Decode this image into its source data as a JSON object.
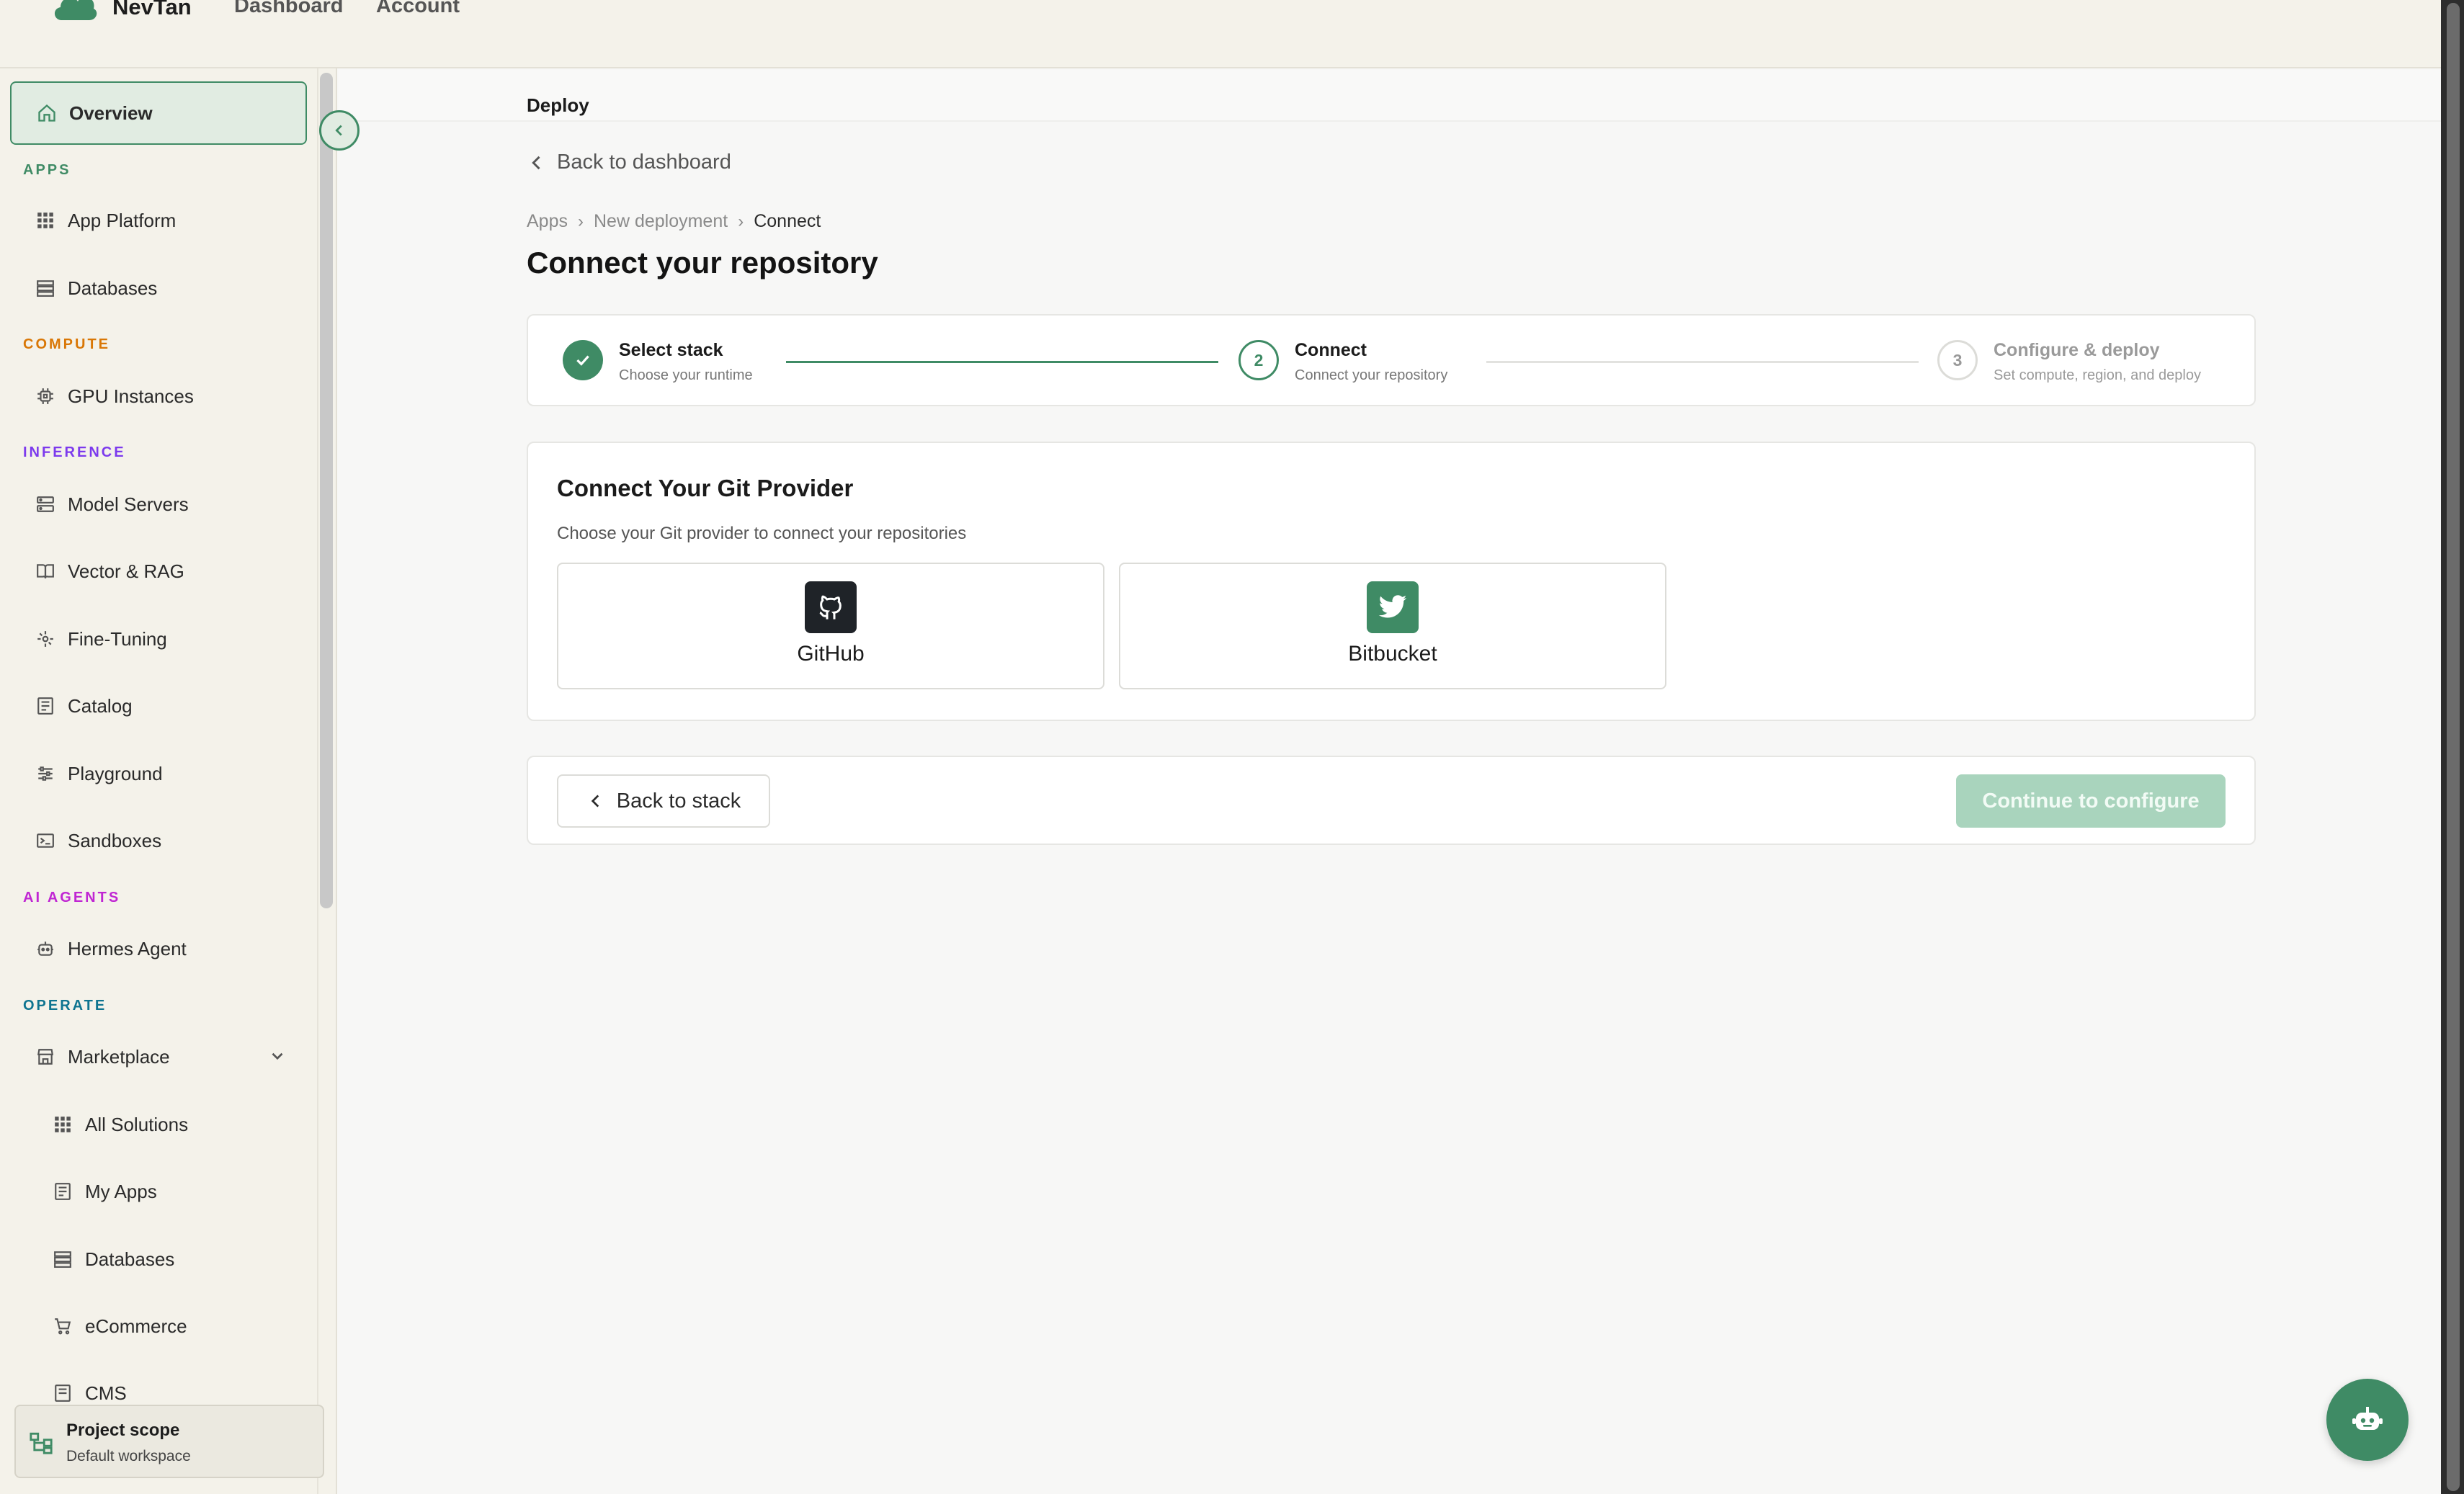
{
  "topbar": {
    "brand": "NevTan",
    "nav": [
      "Dashboard",
      "Account"
    ]
  },
  "sidebar": {
    "overview": "Overview",
    "sections": {
      "apps": "APPS",
      "compute": "COMPUTE",
      "inference": "INFERENCE",
      "ai_agents": "AI AGENTS",
      "operate": "OPERATE"
    },
    "section_colors": {
      "apps": "#3f8b65",
      "compute": "#d97706",
      "inference": "#7c3aed",
      "ai_agents": "#c026d3",
      "operate": "#0e7490"
    },
    "items": {
      "app_platform": "App Platform",
      "databases": "Databases",
      "gpu_instances": "GPU Instances",
      "model_servers": "Model Servers",
      "vector_rag": "Vector & RAG",
      "fine_tuning": "Fine-Tuning",
      "catalog": "Catalog",
      "playground": "Playground",
      "sandboxes": "Sandboxes",
      "hermes_agent": "Hermes Agent",
      "marketplace": "Marketplace",
      "all_solutions": "All Solutions",
      "my_apps": "My Apps",
      "mp_databases": "Databases",
      "ecommerce": "eCommerce",
      "cms": "CMS"
    },
    "project_scope": {
      "title": "Project scope",
      "subtitle": "Default workspace"
    }
  },
  "main": {
    "section_title": "Deploy",
    "back_link": "Back to dashboard",
    "breadcrumb": [
      "Apps",
      "New deployment",
      "Connect"
    ],
    "breadcrumb_sep": "›",
    "title": "Connect your repository",
    "steps": [
      {
        "number": "1",
        "title": "Select stack",
        "subtitle": "Choose your runtime",
        "state": "done"
      },
      {
        "number": "2",
        "title": "Connect",
        "subtitle": "Connect your repository",
        "state": "current"
      },
      {
        "number": "3",
        "title": "Configure & deploy",
        "subtitle": "Set compute, region, and deploy",
        "state": "upcoming"
      }
    ],
    "git": {
      "title": "Connect Your Git Provider",
      "subtitle": "Choose your Git provider to connect your repositories",
      "providers": [
        {
          "label": "GitHub",
          "icon": "github-icon",
          "color": "#1f2328"
        },
        {
          "label": "Bitbucket",
          "icon": "bird-icon",
          "color": "#3f8b65"
        }
      ]
    },
    "actions": {
      "back": "Back to stack",
      "continue": "Continue to configure"
    }
  },
  "colors": {
    "accent": "#3f8b65",
    "accent_light": "#e1ece2",
    "continue_disabled": "#a9d4bd"
  }
}
